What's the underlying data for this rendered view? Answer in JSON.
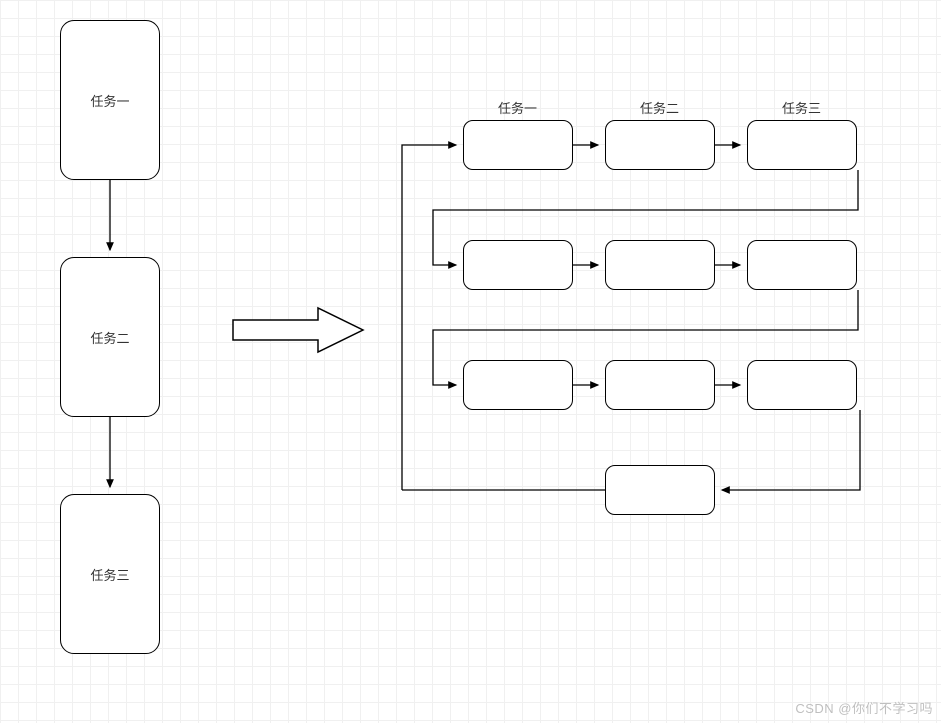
{
  "left_boxes": {
    "task1": "任务一",
    "task2": "任务二",
    "task3": "任务三"
  },
  "right_headers": {
    "col1": "任务一",
    "col2": "任务二",
    "col3": "任务三"
  },
  "watermark": "CSDN @你们不学习吗"
}
